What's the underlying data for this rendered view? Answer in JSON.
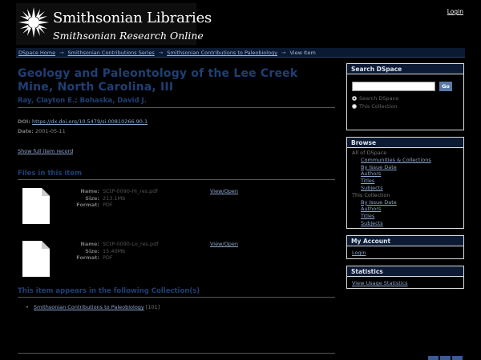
{
  "header": {
    "logo_title": "Smithsonian Libraries",
    "logo_subtitle": "Smithsonian Research Online",
    "login_label": "Login"
  },
  "breadcrumb": {
    "items": [
      "DSpace Home",
      "Smithsonian Contributions Series",
      "Smithsonian Contributions to Paleobiology"
    ],
    "current": "View Item",
    "separator": "→"
  },
  "item": {
    "title": "Geology and Paleontology of the Lee Creek Mine, North Carolina, III",
    "authors": "Ray, Clayton E.; Bohaska, David J.",
    "doi_label": "DOI:",
    "doi_value": "https://dx.doi.org/10.5479/si.00810266.90.1",
    "date_label": "Date:",
    "date_value": "2001-05-11",
    "show_full": "Show full item record"
  },
  "files": {
    "heading": "Files in this item",
    "name_label": "Name:",
    "size_label": "Size:",
    "format_label": "Format:",
    "entries": [
      {
        "name": "SCtP-0090-Hi_res.pdf",
        "size": "213.1Mb",
        "format": "PDF",
        "view": "View/Open"
      },
      {
        "name": "SCtP-0090-Lo_res.pdf",
        "size": "15.40Mb",
        "format": "PDF",
        "view": "View/Open"
      }
    ]
  },
  "collections": {
    "heading": "This item appears in the following Collection(s)",
    "items": [
      {
        "name": "Smithsonian Contributions to Paleobiology",
        "count": "[101]"
      }
    ]
  },
  "sidebar": {
    "search": {
      "heading": "Search DSpace",
      "go_label": "Go",
      "options": [
        "Search DSpace",
        "This Collection"
      ]
    },
    "browse": {
      "heading": "Browse",
      "group1": "All of DSpace",
      "group1_links": [
        "Communities & Collections",
        "By Issue Date",
        "Authors",
        "Titles",
        "Subjects"
      ],
      "group2": "This Collection",
      "group2_links": [
        "By Issue Date",
        "Authors",
        "Titles",
        "Subjects"
      ]
    },
    "account": {
      "heading": "My Account",
      "login": "Login"
    },
    "statistics": {
      "heading": "Statistics",
      "link": "View Usage Statistics"
    }
  },
  "colors": {
    "background": "#000000",
    "heading_blue": "#1f3f74",
    "link": "#8fa7cf",
    "sidebar_header": "#0c1a34"
  }
}
